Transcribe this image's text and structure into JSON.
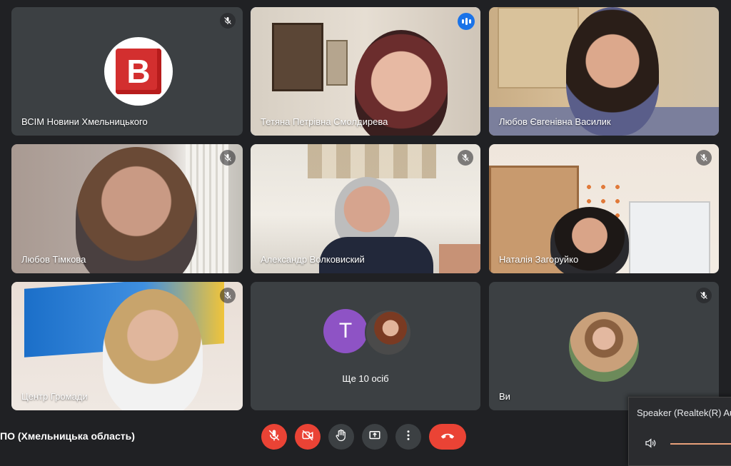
{
  "tiles": [
    {
      "name": "ВСІМ Новини Хмельницького",
      "mic": "muted",
      "avatar_letter": "B"
    },
    {
      "name": "Тетяна Петрівна Смолдирева",
      "mic": "speaking"
    },
    {
      "name": "Любов Євгенівна Василик",
      "mic": "none"
    },
    {
      "name": "Любов Тімкова",
      "mic": "muted"
    },
    {
      "name": "Александр Волковиский",
      "mic": "muted"
    },
    {
      "name": "Наталія Загоруйко",
      "mic": "muted"
    },
    {
      "name": "Центр Громади",
      "mic": "muted"
    },
    {
      "name": "Ще 10 осіб",
      "avatar_letter": "T"
    },
    {
      "name": "Ви",
      "mic": "muted"
    }
  ],
  "meeting_title": "ПО (Хмельницька область)",
  "controls": {
    "mic": "mic-off-icon",
    "camera": "camera-off-icon",
    "raise_hand": "hand-icon",
    "present": "present-screen-icon",
    "more": "more-vert-icon",
    "hangup": "hang-up-icon"
  },
  "speaker": {
    "label": "Speaker (Realtek(R) Au"
  },
  "colors": {
    "active_border": "#8ab4f8",
    "danger": "#ea4335",
    "avatar_purple": "#8e53c5"
  }
}
